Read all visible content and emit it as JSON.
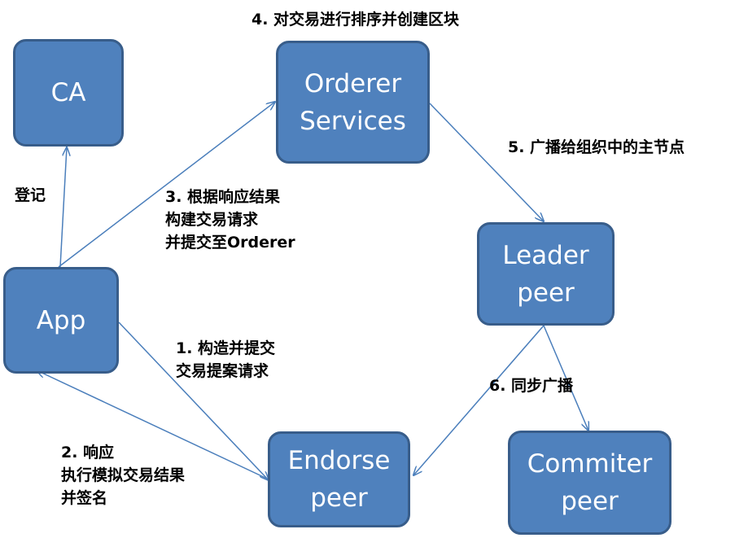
{
  "colors": {
    "node_fill": "#4f81bd",
    "node_border": "#385d8a",
    "node_text": "#ffffff",
    "arrow": "#4a7ebb",
    "label_text": "#000000"
  },
  "nodes": {
    "ca": {
      "label": "CA"
    },
    "orderer": {
      "label": "Orderer\nServices"
    },
    "app": {
      "label": "App"
    },
    "leader": {
      "label": "Leader\npeer"
    },
    "endorse": {
      "label": "Endorse\npeer"
    },
    "commiter": {
      "label": "Commiter\npeer"
    }
  },
  "labels": {
    "step4": "4. 对交易进行排序并创建区块",
    "register": "登记",
    "step3": "3. 根据响应结果\n构建交易请求\n并提交至Orderer",
    "step5": "5. 广播给组织中的主节点",
    "step1": "1.   构造并提交\n交易提案请求",
    "step6": "6. 同步广播",
    "step2": "2. 响应\n执行模拟交易结果\n并签名"
  }
}
